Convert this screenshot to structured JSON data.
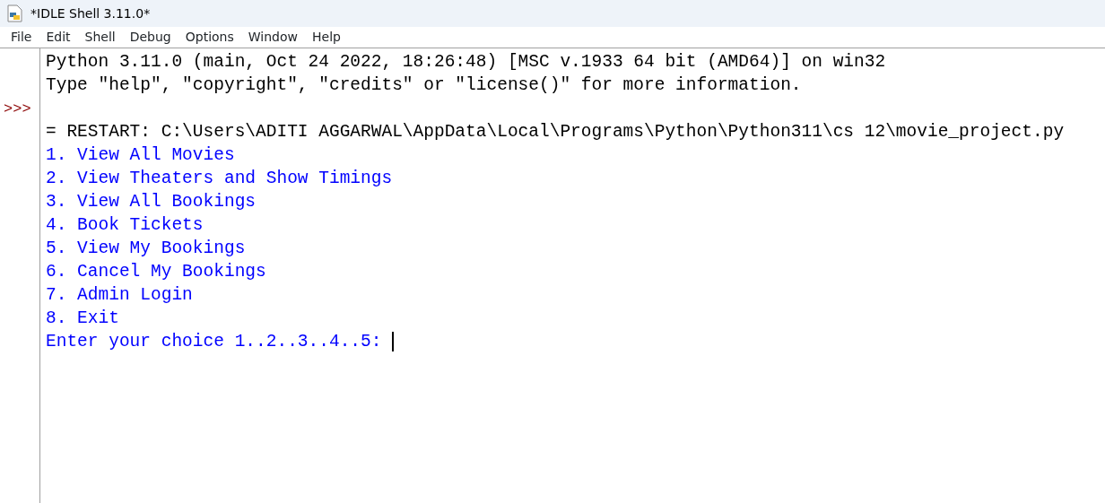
{
  "window": {
    "title": "*IDLE Shell 3.11.0*"
  },
  "menu": [
    "File",
    "Edit",
    "Shell",
    "Debug",
    "Options",
    "Window",
    "Help"
  ],
  "lines": [
    {
      "kind": "output",
      "text": "Python 3.11.0 (main, Oct 24 2022, 18:26:48) [MSC v.1933 64 bit (AMD64)] on win32"
    },
    {
      "kind": "output",
      "text": "Type \"help\", \"copyright\", \"credits\" or \"license()\" for more information."
    },
    {
      "kind": "prompt",
      "prompt": ">>>"
    },
    {
      "kind": "output",
      "text": "= RESTART: C:\\Users\\ADITI AGGARWAL\\AppData\\Local\\Programs\\Python\\Python311\\cs 12\\movie_project.py"
    },
    {
      "kind": "stdout",
      "text": "1. View All Movies"
    },
    {
      "kind": "stdout",
      "text": "2. View Theaters and Show Timings"
    },
    {
      "kind": "stdout",
      "text": "3. View All Bookings"
    },
    {
      "kind": "stdout",
      "text": "4. Book Tickets"
    },
    {
      "kind": "stdout",
      "text": "5. View My Bookings"
    },
    {
      "kind": "stdout",
      "text": "6. Cancel My Bookings"
    },
    {
      "kind": "stdout",
      "text": "7. Admin Login"
    },
    {
      "kind": "stdout",
      "text": "8. Exit"
    },
    {
      "kind": "stdout",
      "text": "Enter your choice 1..2..3..4..5: ",
      "cursor": true
    }
  ]
}
